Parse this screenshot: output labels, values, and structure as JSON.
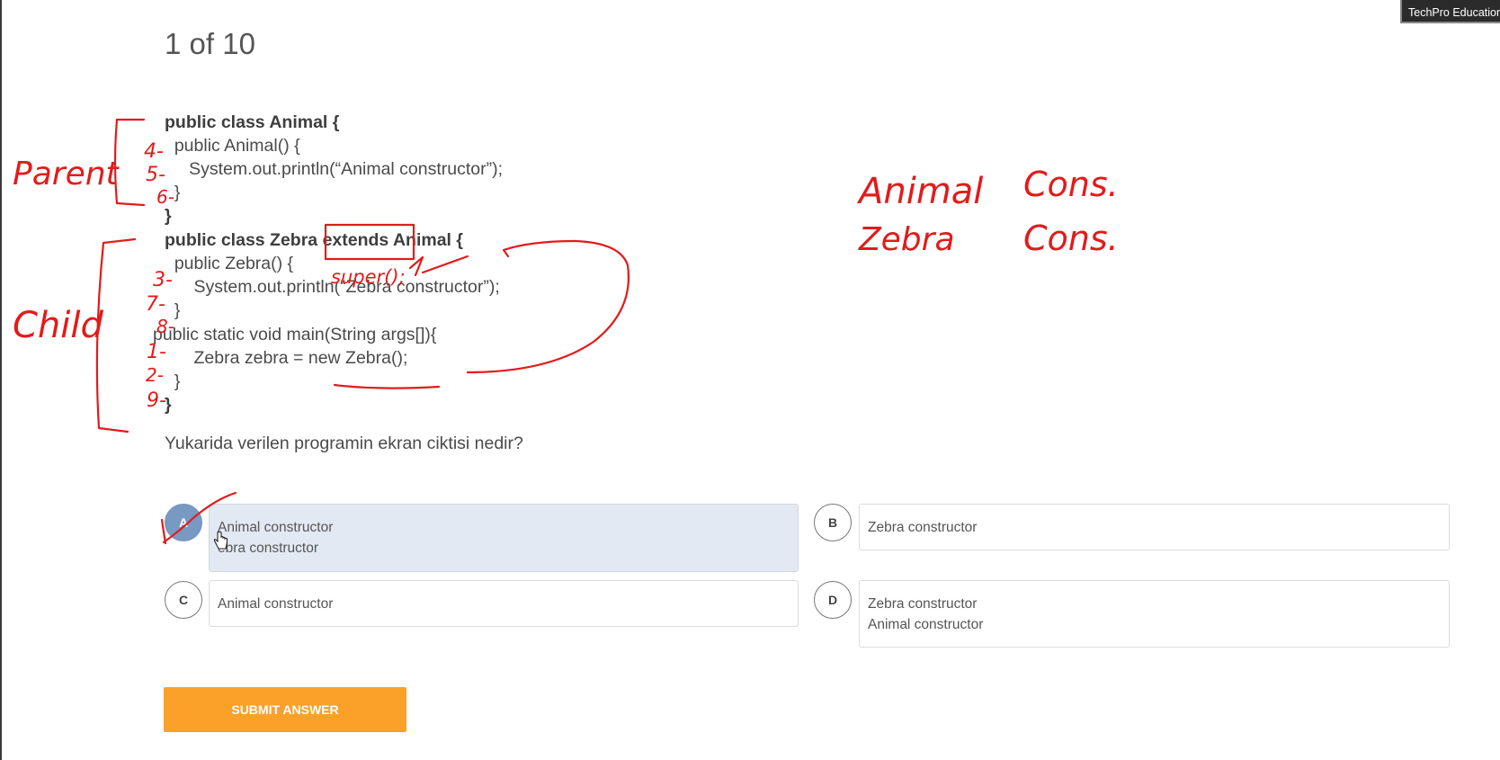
{
  "quiz": {
    "counter": "1 of 10"
  },
  "code_lines": [
    "public class Animal {",
    "  public Animal() {",
    "     System.out.println(“Animal constructor”);",
    "  }",
    "}",
    "public class Zebra extends Animal {",
    "  public Zebra() {",
    "      System.out.println(“Zebra constructor”);",
    "  }",
    "public static void main(String args[]){",
    "      Zebra zebra = new Zebra();",
    "  }",
    "}"
  ],
  "question": "Yukarida verilen programin ekran ciktisi nedir?",
  "options": [
    {
      "letter": "A",
      "lines": [
        "Animal constructor",
        "ebra constructor"
      ],
      "selected": true
    },
    {
      "letter": "B",
      "lines": [
        "Zebra constructor"
      ],
      "selected": false
    },
    {
      "letter": "C",
      "lines": [
        "Animal constructor"
      ],
      "selected": false
    },
    {
      "letter": "D",
      "lines": [
        "Zebra constructor",
        "Animal constructor"
      ],
      "selected": false
    }
  ],
  "submit_label": "SUBMIT ANSWER",
  "overlay_tag": "TechPro Education",
  "annotations": {
    "parent": "Parent",
    "child": "Child",
    "super": "super();",
    "order_numbers": [
      "4-",
      "5-",
      "6-",
      "3-",
      "7-",
      "8-",
      "1-",
      "2-",
      "9-"
    ],
    "notes": [
      [
        "Animal",
        "Cons."
      ],
      [
        "Zebra",
        "Cons."
      ]
    ]
  },
  "colors": {
    "accent": "#fba12a",
    "selected": "#7799c2",
    "selected_bg": "#e3e9f3",
    "ink": "#e21b1b"
  }
}
